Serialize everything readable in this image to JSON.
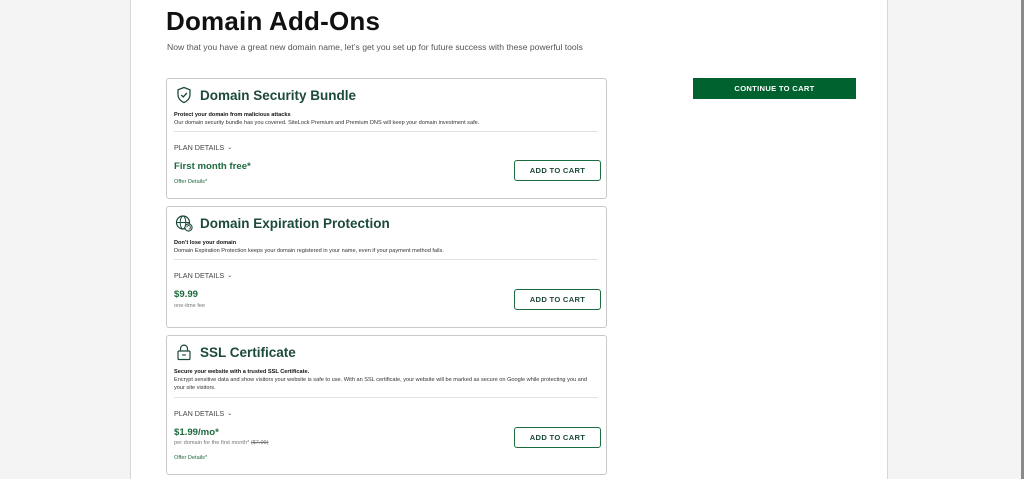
{
  "page": {
    "title": "Domain Add-Ons",
    "subtitle": "Now that you have a great new domain name, let’s get you set up for future success with these powerful tools"
  },
  "cta": {
    "label": "CONTINUE TO CART"
  },
  "colors": {
    "brand_green": "#00622f",
    "title_green": "#1d4a3a",
    "price_green": "#1d6a3e"
  },
  "cards": [
    {
      "icon": "shield-check-icon",
      "title": "Domain Security Bundle",
      "tagline": "Protect your domain from malicious attacks",
      "description": "Our domain security bundle has you covered. SiteLock Premium and Premium DNS will keep your domain investment safe.",
      "plan_details": "PLAN DETAILS",
      "price": "First month free*",
      "price_sub": "",
      "price_sub_strike": "",
      "offer_details": "Offer Details*",
      "add_label": "ADD TO CART"
    },
    {
      "icon": "globe-refresh-icon",
      "title": "Domain Expiration Protection",
      "tagline": "Don’t lose your domain",
      "description": "Domain Expiration Protection keeps your domain registered in your name, even if your payment method fails.",
      "plan_details": "PLAN DETAILS",
      "price": "$9.99",
      "price_sub": "one-time fee",
      "price_sub_strike": "",
      "offer_details": "",
      "add_label": "ADD TO CART"
    },
    {
      "icon": "lock-icon",
      "title": "SSL Certificate",
      "tagline": "Secure your website with a trusted SSL Certificate.",
      "description": "Encrypt sensitive data and show visitors your website is safe to use. With an SSL certificate, your website will be marked as secure on Google while protecting you and your site visitors.",
      "plan_details": "PLAN DETAILS",
      "price": "$1.99/mo*",
      "price_sub": "per domain for the first month*",
      "price_sub_strike": "($7.99)",
      "offer_details": "Offer Details*",
      "add_label": "ADD TO CART"
    }
  ]
}
